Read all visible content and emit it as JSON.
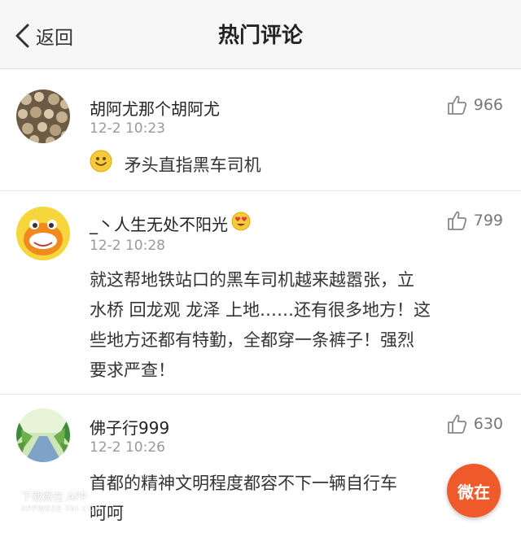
{
  "nav": {
    "back_label": "返回",
    "title": "热门评论"
  },
  "comments": [
    {
      "author": "胡阿尤那个胡阿尤",
      "time": "12-2 10:23",
      "likes": "966",
      "text": "矛头直指黑车司机",
      "text_prefix_icon": "smiley-emoji-icon"
    },
    {
      "author": "_丶人生无处不阳光",
      "author_suffix_icon": "heart-eyes-emoji-icon",
      "time": "12-2 10:28",
      "likes": "799",
      "lines": [
        "就这帮地铁站口的黑车司机越来越嚣张，立",
        "水桥 回龙观 龙泽 上地……还有很多地方！这",
        "些地方还都有特勤，全都穿一条裤子！强烈",
        "要求严查！"
      ]
    },
    {
      "author": "佛子行999",
      "time": "12-2 10:26",
      "likes": "630",
      "lines": [
        "首都的精神文明程度都容不下一辆自行车",
        "呵呵"
      ]
    }
  ],
  "fab_label": "微在",
  "watermark": {
    "line1": "下载微在 APP",
    "line2": "APPWEZE TAI.COM"
  },
  "colors": {
    "fab": "#ef5a2a",
    "time_text": "#999999",
    "nav_bg": "#f7f7f7"
  }
}
